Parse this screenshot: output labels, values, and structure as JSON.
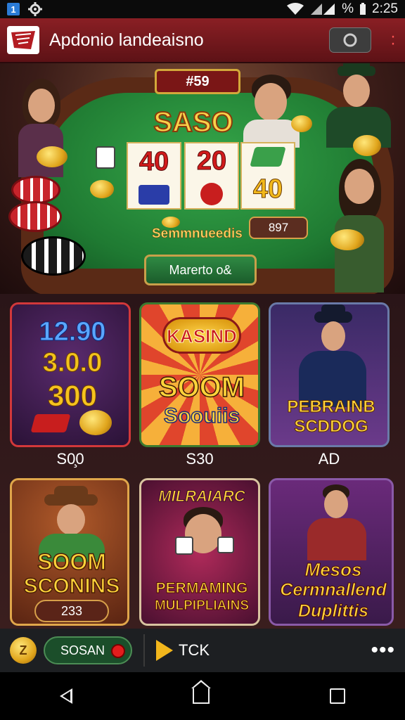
{
  "status": {
    "notif_count": "1",
    "battery": "%",
    "time": "2:25"
  },
  "app": {
    "title": "Apdonio landeaisno"
  },
  "hero": {
    "plaque": "#59",
    "title": "SASO",
    "cards": [
      "40",
      "20",
      "40"
    ],
    "felt_label": "Semmnueedis",
    "felt_value": "897",
    "button_label": "Marerto o&"
  },
  "tiles": [
    {
      "lines": [
        "12.90",
        "3.0.0",
        "300"
      ],
      "caption": "S0̧0"
    },
    {
      "lines": [
        "KASIND",
        "SOOM",
        "Soouiis"
      ],
      "caption": "S30"
    },
    {
      "lines": [
        "PEBRAINB",
        "SCDDOG"
      ],
      "caption": "AD"
    },
    {
      "lines": [
        "SOOM",
        "SCONINS"
      ],
      "badge": "233"
    },
    {
      "lines": [
        "MILRAIARC",
        "PERMAMING",
        "MULPIPLIAINS"
      ]
    },
    {
      "lines": [
        "Mesos",
        "Cermnallend",
        "Duplittis"
      ]
    }
  ],
  "bottom": {
    "coin_label": "Z",
    "button_label": "SOSAN",
    "play_label": "TCK"
  },
  "colors": {
    "primary": "#8a1f24",
    "felt": "#1f7a32",
    "gold": "#f2b91c"
  }
}
